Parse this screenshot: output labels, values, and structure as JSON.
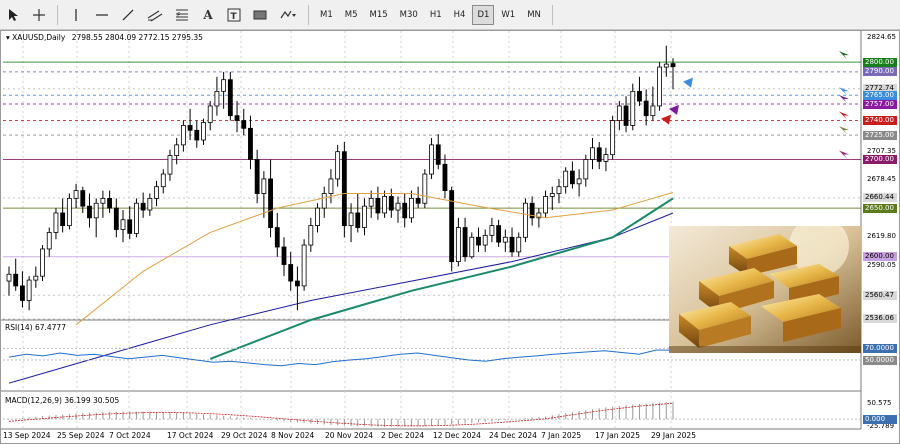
{
  "toolbar": {
    "timeframes": [
      {
        "label": "M1",
        "active": false
      },
      {
        "label": "M5",
        "active": false
      },
      {
        "label": "M15",
        "active": false
      },
      {
        "label": "M30",
        "active": false
      },
      {
        "label": "H1",
        "active": false
      },
      {
        "label": "H4",
        "active": false
      },
      {
        "label": "D1",
        "active": true
      },
      {
        "label": "W1",
        "active": false
      },
      {
        "label": "MN",
        "active": false
      }
    ]
  },
  "chart": {
    "symbol_label": "XAUUSD,Daily",
    "ohlc_label": "2798.55 2804.09 2772.15 2795.35",
    "ylim": [
      2536,
      2830
    ]
  },
  "price_tags": [
    {
      "label": "2800.00",
      "value": 2800,
      "color": "#1a7f1a",
      "text_color": "#ffffff"
    },
    {
      "label": "2790.00",
      "value": 2790,
      "color": "#7a6ab8",
      "text_color": "#ffffff"
    },
    {
      "label": "2772.74",
      "value": 2772.74,
      "color": "#d8d8d8",
      "text_color": "#000000"
    },
    {
      "label": "2765.00",
      "value": 2766,
      "color": "#3b8de0",
      "text_color": "#ffffff"
    },
    {
      "label": "2757.00",
      "value": 2757,
      "color": "#8a1aa0",
      "text_color": "#ffffff"
    },
    {
      "label": "2740.00",
      "value": 2740,
      "color": "#c81e1e",
      "text_color": "#ffffff"
    },
    {
      "label": "2725.00",
      "value": 2725,
      "color": "#8a8a8a",
      "text_color": "#ffffff"
    },
    {
      "label": "2700.00",
      "value": 2700,
      "color": "#8a1a6a",
      "text_color": "#ffffff"
    },
    {
      "label": "2660.44",
      "value": 2660.44,
      "color": "#d8d8d8",
      "text_color": "#000000"
    },
    {
      "label": "2650.00",
      "value": 2650,
      "color": "#5b7a1a",
      "text_color": "#ffffff"
    },
    {
      "label": "2600.00",
      "value": 2600,
      "color": "#c8a0e0",
      "text_color": "#000000"
    },
    {
      "label": "2560.47",
      "value": 2560.47,
      "color": "#d8d8d8",
      "text_color": "#000000"
    },
    {
      "label": "2536.06",
      "value": 2536.06,
      "color": "#d8d8d8",
      "text_color": "#000000"
    }
  ],
  "axis_ticks": [
    {
      "label": "2824.65",
      "value": 2824.65
    },
    {
      "label": "2707.35",
      "value": 2707.35
    },
    {
      "label": "2678.45",
      "value": 2678.45
    },
    {
      "label": "2619.80",
      "value": 2619.8
    },
    {
      "label": "2590.05",
      "value": 2590.05
    }
  ],
  "rsi": {
    "label": "RSI(14) 67.4777",
    "ylim": [
      0,
      100
    ],
    "level_tags": [
      {
        "label": "70.0000",
        "value": 70,
        "color": "#3b6fb0",
        "text_color": "#ffffff"
      },
      {
        "label": "50.0000",
        "value": 50,
        "color": "#8a8a8a",
        "text_color": "#ffffff"
      }
    ]
  },
  "macd": {
    "label": "MACD(12,26,9) 36.199 30.505",
    "ylim": [
      -25.789,
      60
    ],
    "ticks": [
      {
        "label": "50.575",
        "value": 50.575
      },
      {
        "label": "-25.789",
        "value": -25.789
      }
    ],
    "zero_tag": {
      "label": "0.000",
      "value": 0,
      "color": "#3b6fb0",
      "text_color": "#ffffff"
    }
  },
  "date_axis": [
    "13 Sep 2024",
    "25 Sep 2024",
    "7 Oct 2024",
    "17 Oct 2024",
    "29 Oct 2024",
    "8 Nov 2024",
    "20 Nov 2024",
    "2 Dec 2024",
    "12 Dec 2024",
    "24 Dec 2024",
    "7 Jan 2025",
    "17 Jan 2025",
    "29 Jan 2025"
  ],
  "arrows": [
    {
      "target": 2800,
      "color": "#1a6b1a"
    },
    {
      "target": 2765,
      "color": "#3b8de0"
    },
    {
      "target": 2757,
      "color": "#7a1a9a"
    },
    {
      "target": 2740,
      "color": "#c81e1e"
    },
    {
      "target": 2725,
      "color": "#7a8a3a"
    },
    {
      "target": 2700,
      "color": "#9a1a7a"
    }
  ],
  "chart_data": {
    "type": "candlestick",
    "series": [
      {
        "candles": [
          {
            "o": 2575,
            "h": 2590,
            "l": 2560,
            "c": 2582
          },
          {
            "o": 2582,
            "h": 2598,
            "l": 2565,
            "c": 2570
          },
          {
            "o": 2570,
            "h": 2585,
            "l": 2548,
            "c": 2555
          },
          {
            "o": 2555,
            "h": 2580,
            "l": 2545,
            "c": 2576
          },
          {
            "o": 2576,
            "h": 2590,
            "l": 2568,
            "c": 2580
          },
          {
            "o": 2580,
            "h": 2612,
            "l": 2575,
            "c": 2608
          },
          {
            "o": 2608,
            "h": 2630,
            "l": 2600,
            "c": 2625
          },
          {
            "o": 2625,
            "h": 2650,
            "l": 2618,
            "c": 2645
          },
          {
            "o": 2645,
            "h": 2660,
            "l": 2625,
            "c": 2632
          },
          {
            "o": 2632,
            "h": 2665,
            "l": 2628,
            "c": 2660
          },
          {
            "o": 2660,
            "h": 2675,
            "l": 2650,
            "c": 2668
          },
          {
            "o": 2668,
            "h": 2672,
            "l": 2645,
            "c": 2652
          },
          {
            "o": 2652,
            "h": 2665,
            "l": 2630,
            "c": 2640
          },
          {
            "o": 2640,
            "h": 2660,
            "l": 2620,
            "c": 2655
          },
          {
            "o": 2655,
            "h": 2668,
            "l": 2640,
            "c": 2660
          },
          {
            "o": 2660,
            "h": 2668,
            "l": 2645,
            "c": 2650
          },
          {
            "o": 2650,
            "h": 2660,
            "l": 2620,
            "c": 2628
          },
          {
            "o": 2628,
            "h": 2648,
            "l": 2615,
            "c": 2638
          },
          {
            "o": 2638,
            "h": 2652,
            "l": 2618,
            "c": 2624
          },
          {
            "o": 2624,
            "h": 2660,
            "l": 2620,
            "c": 2655
          },
          {
            "o": 2655,
            "h": 2666,
            "l": 2640,
            "c": 2648
          },
          {
            "o": 2648,
            "h": 2665,
            "l": 2642,
            "c": 2660
          },
          {
            "o": 2660,
            "h": 2678,
            "l": 2652,
            "c": 2672
          },
          {
            "o": 2672,
            "h": 2690,
            "l": 2665,
            "c": 2685
          },
          {
            "o": 2685,
            "h": 2710,
            "l": 2678,
            "c": 2704
          },
          {
            "o": 2704,
            "h": 2722,
            "l": 2695,
            "c": 2715
          },
          {
            "o": 2715,
            "h": 2740,
            "l": 2708,
            "c": 2735
          },
          {
            "o": 2735,
            "h": 2752,
            "l": 2720,
            "c": 2730
          },
          {
            "o": 2730,
            "h": 2740,
            "l": 2712,
            "c": 2720
          },
          {
            "o": 2720,
            "h": 2742,
            "l": 2715,
            "c": 2738
          },
          {
            "o": 2738,
            "h": 2760,
            "l": 2730,
            "c": 2755
          },
          {
            "o": 2755,
            "h": 2785,
            "l": 2745,
            "c": 2770
          },
          {
            "o": 2770,
            "h": 2790,
            "l": 2752,
            "c": 2782
          },
          {
            "o": 2782,
            "h": 2790,
            "l": 2740,
            "c": 2745
          },
          {
            "o": 2745,
            "h": 2760,
            "l": 2728,
            "c": 2740
          },
          {
            "o": 2740,
            "h": 2752,
            "l": 2725,
            "c": 2732
          },
          {
            "o": 2732,
            "h": 2745,
            "l": 2690,
            "c": 2700
          },
          {
            "o": 2700,
            "h": 2710,
            "l": 2655,
            "c": 2665
          },
          {
            "o": 2665,
            "h": 2688,
            "l": 2640,
            "c": 2680
          },
          {
            "o": 2680,
            "h": 2700,
            "l": 2620,
            "c": 2630
          },
          {
            "o": 2630,
            "h": 2645,
            "l": 2600,
            "c": 2610
          },
          {
            "o": 2610,
            "h": 2620,
            "l": 2580,
            "c": 2592
          },
          {
            "o": 2592,
            "h": 2605,
            "l": 2565,
            "c": 2575
          },
          {
            "o": 2575,
            "h": 2590,
            "l": 2545,
            "c": 2570
          },
          {
            "o": 2570,
            "h": 2618,
            "l": 2565,
            "c": 2612
          },
          {
            "o": 2612,
            "h": 2640,
            "l": 2605,
            "c": 2632
          },
          {
            "o": 2632,
            "h": 2655,
            "l": 2625,
            "c": 2650
          },
          {
            "o": 2650,
            "h": 2672,
            "l": 2640,
            "c": 2665
          },
          {
            "o": 2665,
            "h": 2690,
            "l": 2655,
            "c": 2680
          },
          {
            "o": 2680,
            "h": 2715,
            "l": 2672,
            "c": 2708
          },
          {
            "o": 2708,
            "h": 2718,
            "l": 2620,
            "c": 2632
          },
          {
            "o": 2632,
            "h": 2655,
            "l": 2615,
            "c": 2645
          },
          {
            "o": 2645,
            "h": 2665,
            "l": 2625,
            "c": 2630
          },
          {
            "o": 2630,
            "h": 2660,
            "l": 2622,
            "c": 2652
          },
          {
            "o": 2652,
            "h": 2668,
            "l": 2640,
            "c": 2660
          },
          {
            "o": 2660,
            "h": 2672,
            "l": 2638,
            "c": 2645
          },
          {
            "o": 2645,
            "h": 2668,
            "l": 2640,
            "c": 2662
          },
          {
            "o": 2662,
            "h": 2670,
            "l": 2640,
            "c": 2648
          },
          {
            "o": 2648,
            "h": 2662,
            "l": 2635,
            "c": 2655
          },
          {
            "o": 2655,
            "h": 2665,
            "l": 2630,
            "c": 2640
          },
          {
            "o": 2640,
            "h": 2668,
            "l": 2635,
            "c": 2660
          },
          {
            "o": 2660,
            "h": 2672,
            "l": 2650,
            "c": 2655
          },
          {
            "o": 2655,
            "h": 2690,
            "l": 2650,
            "c": 2685
          },
          {
            "o": 2685,
            "h": 2722,
            "l": 2680,
            "c": 2715
          },
          {
            "o": 2715,
            "h": 2726,
            "l": 2690,
            "c": 2695
          },
          {
            "o": 2695,
            "h": 2705,
            "l": 2660,
            "c": 2668
          },
          {
            "o": 2668,
            "h": 2672,
            "l": 2585,
            "c": 2595
          },
          {
            "o": 2595,
            "h": 2640,
            "l": 2590,
            "c": 2630
          },
          {
            "o": 2630,
            "h": 2640,
            "l": 2595,
            "c": 2600
          },
          {
            "o": 2600,
            "h": 2625,
            "l": 2598,
            "c": 2620
          },
          {
            "o": 2620,
            "h": 2630,
            "l": 2605,
            "c": 2612
          },
          {
            "o": 2612,
            "h": 2628,
            "l": 2605,
            "c": 2622
          },
          {
            "o": 2622,
            "h": 2640,
            "l": 2615,
            "c": 2632
          },
          {
            "o": 2632,
            "h": 2638,
            "l": 2610,
            "c": 2615
          },
          {
            "o": 2615,
            "h": 2628,
            "l": 2605,
            "c": 2620
          },
          {
            "o": 2620,
            "h": 2630,
            "l": 2600,
            "c": 2605
          },
          {
            "o": 2605,
            "h": 2625,
            "l": 2600,
            "c": 2620
          },
          {
            "o": 2620,
            "h": 2660,
            "l": 2615,
            "c": 2655
          },
          {
            "o": 2655,
            "h": 2662,
            "l": 2632,
            "c": 2640
          },
          {
            "o": 2640,
            "h": 2650,
            "l": 2630,
            "c": 2645
          },
          {
            "o": 2645,
            "h": 2668,
            "l": 2640,
            "c": 2662
          },
          {
            "o": 2662,
            "h": 2672,
            "l": 2648,
            "c": 2665
          },
          {
            "o": 2665,
            "h": 2680,
            "l": 2655,
            "c": 2672
          },
          {
            "o": 2672,
            "h": 2692,
            "l": 2665,
            "c": 2688
          },
          {
            "o": 2688,
            "h": 2698,
            "l": 2670,
            "c": 2675
          },
          {
            "o": 2675,
            "h": 2690,
            "l": 2662,
            "c": 2680
          },
          {
            "o": 2680,
            "h": 2705,
            "l": 2672,
            "c": 2700
          },
          {
            "o": 2700,
            "h": 2722,
            "l": 2690,
            "c": 2712
          },
          {
            "o": 2712,
            "h": 2718,
            "l": 2690,
            "c": 2698
          },
          {
            "o": 2698,
            "h": 2712,
            "l": 2688,
            "c": 2705
          },
          {
            "o": 2705,
            "h": 2745,
            "l": 2700,
            "c": 2740
          },
          {
            "o": 2740,
            "h": 2760,
            "l": 2730,
            "c": 2755
          },
          {
            "o": 2755,
            "h": 2765,
            "l": 2728,
            "c": 2735
          },
          {
            "o": 2735,
            "h": 2778,
            "l": 2730,
            "c": 2770
          },
          {
            "o": 2770,
            "h": 2785,
            "l": 2755,
            "c": 2760
          },
          {
            "o": 2760,
            "h": 2772,
            "l": 2735,
            "c": 2745
          },
          {
            "o": 2745,
            "h": 2775,
            "l": 2740,
            "c": 2755
          },
          {
            "o": 2755,
            "h": 2800,
            "l": 2750,
            "c": 2795
          },
          {
            "o": 2795,
            "h": 2817,
            "l": 2785,
            "c": 2798
          },
          {
            "o": 2798.55,
            "h": 2804.09,
            "l": 2772.15,
            "c": 2795.35
          }
        ]
      },
      {
        "name": "",
        "kind": "ma_slow",
        "points": [
          [
            0,
            2470
          ],
          [
            15,
            2500
          ],
          [
            30,
            2530
          ],
          [
            45,
            2555
          ],
          [
            60,
            2575
          ],
          [
            75,
            2595
          ],
          [
            90,
            2620
          ],
          [
            99,
            2645
          ]
        ]
      },
      {
        "name": "",
        "kind": "ma_mid",
        "points": [
          [
            30,
            2495
          ],
          [
            45,
            2535
          ],
          [
            60,
            2565
          ],
          [
            75,
            2590
          ],
          [
            90,
            2620
          ],
          [
            99,
            2660
          ]
        ]
      },
      {
        "name": "",
        "kind": "ma_fast",
        "points": [
          [
            10,
            2530
          ],
          [
            20,
            2585
          ],
          [
            30,
            2625
          ],
          [
            40,
            2650
          ],
          [
            50,
            2665
          ],
          [
            60,
            2665
          ],
          [
            70,
            2652
          ],
          [
            80,
            2640
          ],
          [
            90,
            2648
          ],
          [
            99,
            2666
          ]
        ]
      }
    ],
    "rsi_values": [
      55,
      60,
      57,
      62,
      58,
      60,
      56,
      52,
      55,
      58,
      54,
      50,
      46,
      48,
      45,
      42,
      40,
      44,
      42,
      47,
      50,
      52,
      56,
      60,
      62,
      58,
      54,
      50,
      48,
      52,
      55,
      57,
      60,
      62,
      64,
      66,
      63,
      60,
      67,
      67
    ]
  }
}
